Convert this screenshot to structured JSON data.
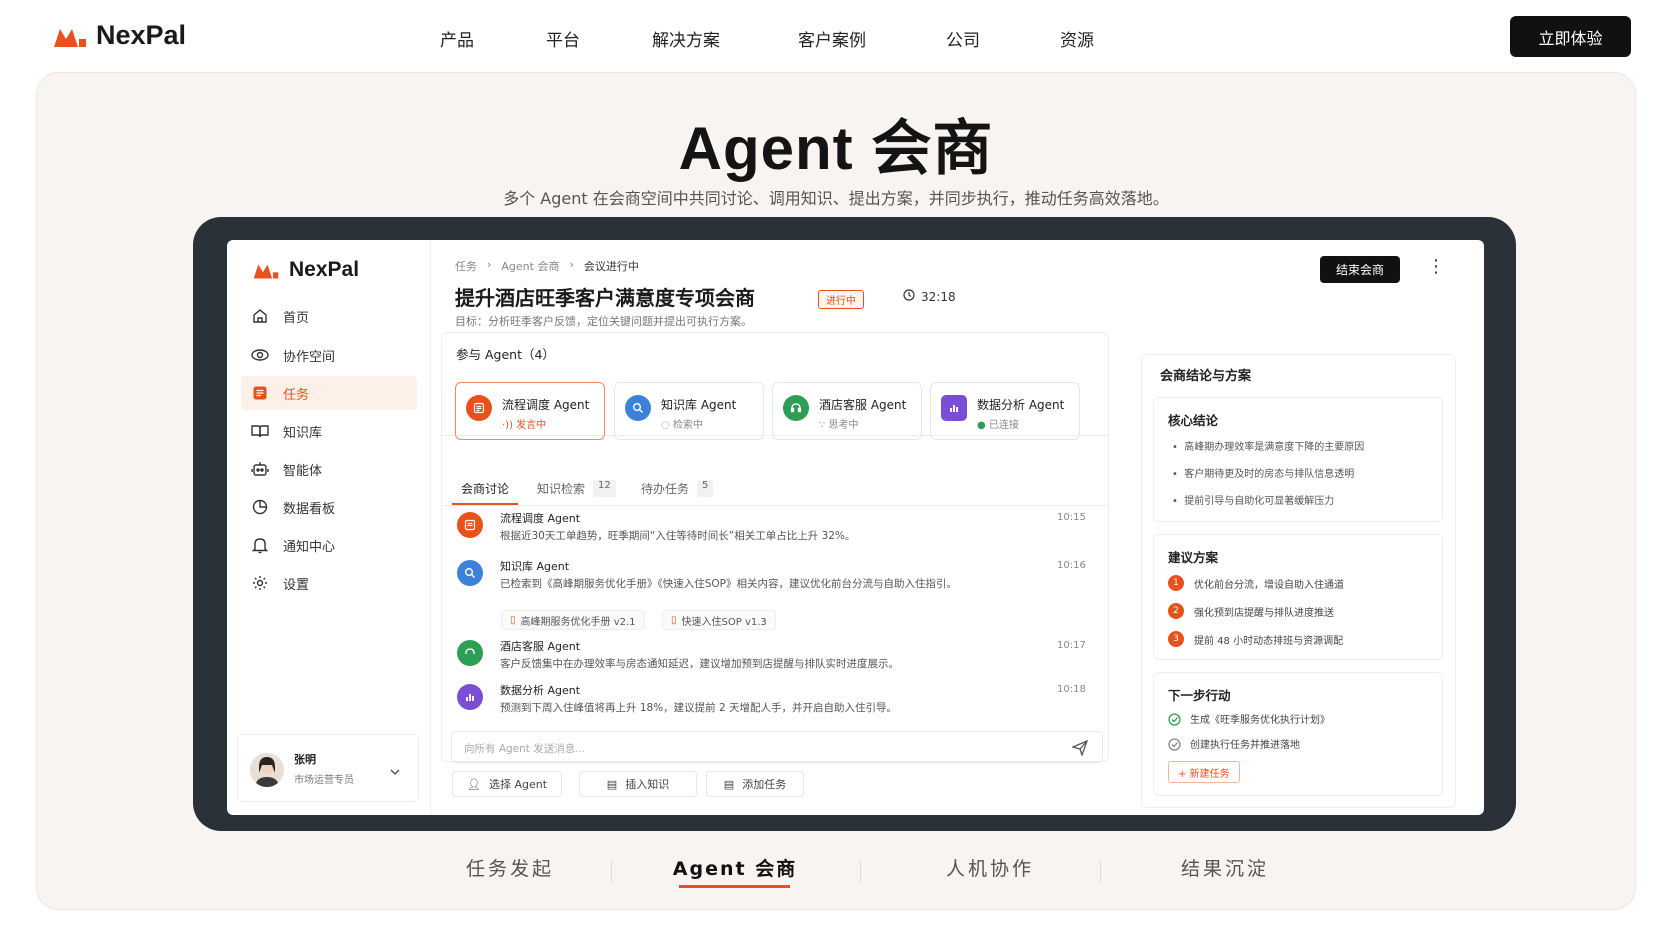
{
  "nav": {
    "brand": "NexPal",
    "links": [
      "产品",
      "平台",
      "解决方案",
      "客户案例",
      "公司",
      "资源"
    ],
    "cta": "立即体验"
  },
  "hero": {
    "title": "Agent 会商",
    "subtitle": "多个 Agent 在会商空间中共同讨论、调用知识、提出方案，并同步执行，推动任务高效落地。"
  },
  "app": {
    "brand": "NexPal",
    "sidebar": [
      {
        "label": "首页",
        "icon": "home-icon"
      },
      {
        "label": "协作空间",
        "icon": "eye-icon"
      },
      {
        "label": "任务",
        "icon": "task-icon",
        "active": true
      },
      {
        "label": "知识库",
        "icon": "book-icon"
      },
      {
        "label": "智能体",
        "icon": "robot-icon"
      },
      {
        "label": "数据看板",
        "icon": "pie-chart-icon"
      },
      {
        "label": "通知中心",
        "icon": "bell-icon"
      },
      {
        "label": "设置",
        "icon": "gear-icon"
      }
    ],
    "user": {
      "name": "张明",
      "role": "市场运营专员"
    },
    "breadcrumb": [
      "任务",
      "Agent 会商",
      "会议进行中"
    ],
    "title": "提升酒店旺季客户满意度专项会商",
    "status": "进行中",
    "timer": "32:18",
    "goal": "目标：分析旺季客户反馈，定位关键问题并提出可执行方案。",
    "end_button": "结束会商",
    "agents_header": "参与 Agent（4）",
    "agents": [
      {
        "name": "流程调度 Agent",
        "status": "发言中",
        "color": "#e8501c"
      },
      {
        "name": "知识库 Agent",
        "status": "检索中",
        "color": "#3b82d8"
      },
      {
        "name": "酒店客服 Agent",
        "status": "思考中",
        "color": "#2f9e55"
      },
      {
        "name": "数据分析 Agent",
        "status": "已连接",
        "color": "#7a4fd6"
      }
    ],
    "tabs": [
      {
        "label": "会商讨论",
        "count": ""
      },
      {
        "label": "知识检索",
        "count": "12"
      },
      {
        "label": "待办任务",
        "count": "5"
      }
    ],
    "messages": [
      {
        "name": "流程调度 Agent",
        "time": "10:15",
        "text": "根据近30天工单趋势，旺季期间“入住等待时间长”相关工单占比上升 32%。",
        "color": "#e8501c"
      },
      {
        "name": "知识库 Agent",
        "time": "10:16",
        "text": "已检索到《高峰期服务优化手册》《快速入住SOP》相关内容，建议优化前台分流与自助入住指引。",
        "color": "#3b82d8"
      },
      {
        "name": "酒店客服 Agent",
        "time": "10:17",
        "text": "客户反馈集中在办理效率与房态通知延迟，建议增加预到店提醒与排队实时进度展示。",
        "color": "#2f9e55"
      },
      {
        "name": "数据分析 Agent",
        "time": "10:18",
        "text": "预测到下周入住峰值将再上升 18%，建议提前 2 天增配人手，并开启自助入住引导。",
        "color": "#7a4fd6"
      }
    ],
    "attachments": [
      "高峰期服务优化手册 v2.1",
      "快速入住SOP v1.3"
    ],
    "input_placeholder": "向所有 Agent 发送消息...",
    "tools": [
      "选择 Agent",
      "插入知识",
      "添加任务"
    ],
    "right": {
      "title": "会商结论与方案",
      "core_title": "核心结论",
      "core": [
        "高峰期办理效率是满意度下降的主要原因",
        "客户期待更及时的房态与排队信息透明",
        "提前引导与自助化可显著缓解压力"
      ],
      "plan_title": "建议方案",
      "plan": [
        "优化前台分流，增设自助入住通道",
        "强化预到店提醒与排队进度推送",
        "提前 48 小时动态排班与资源调配"
      ],
      "next_title": "下一步行动",
      "next": [
        "生成《旺季服务优化执行计划》",
        "创建执行任务并推进落地"
      ],
      "new_task": "+ 新建任务"
    }
  },
  "bottom_tabs": [
    "任务发起",
    "Agent 会商",
    "人机协作",
    "结果沉淀"
  ],
  "colors": {
    "accent": "#e8501c",
    "dark": "#111111",
    "stage": "#f8f4f1"
  }
}
